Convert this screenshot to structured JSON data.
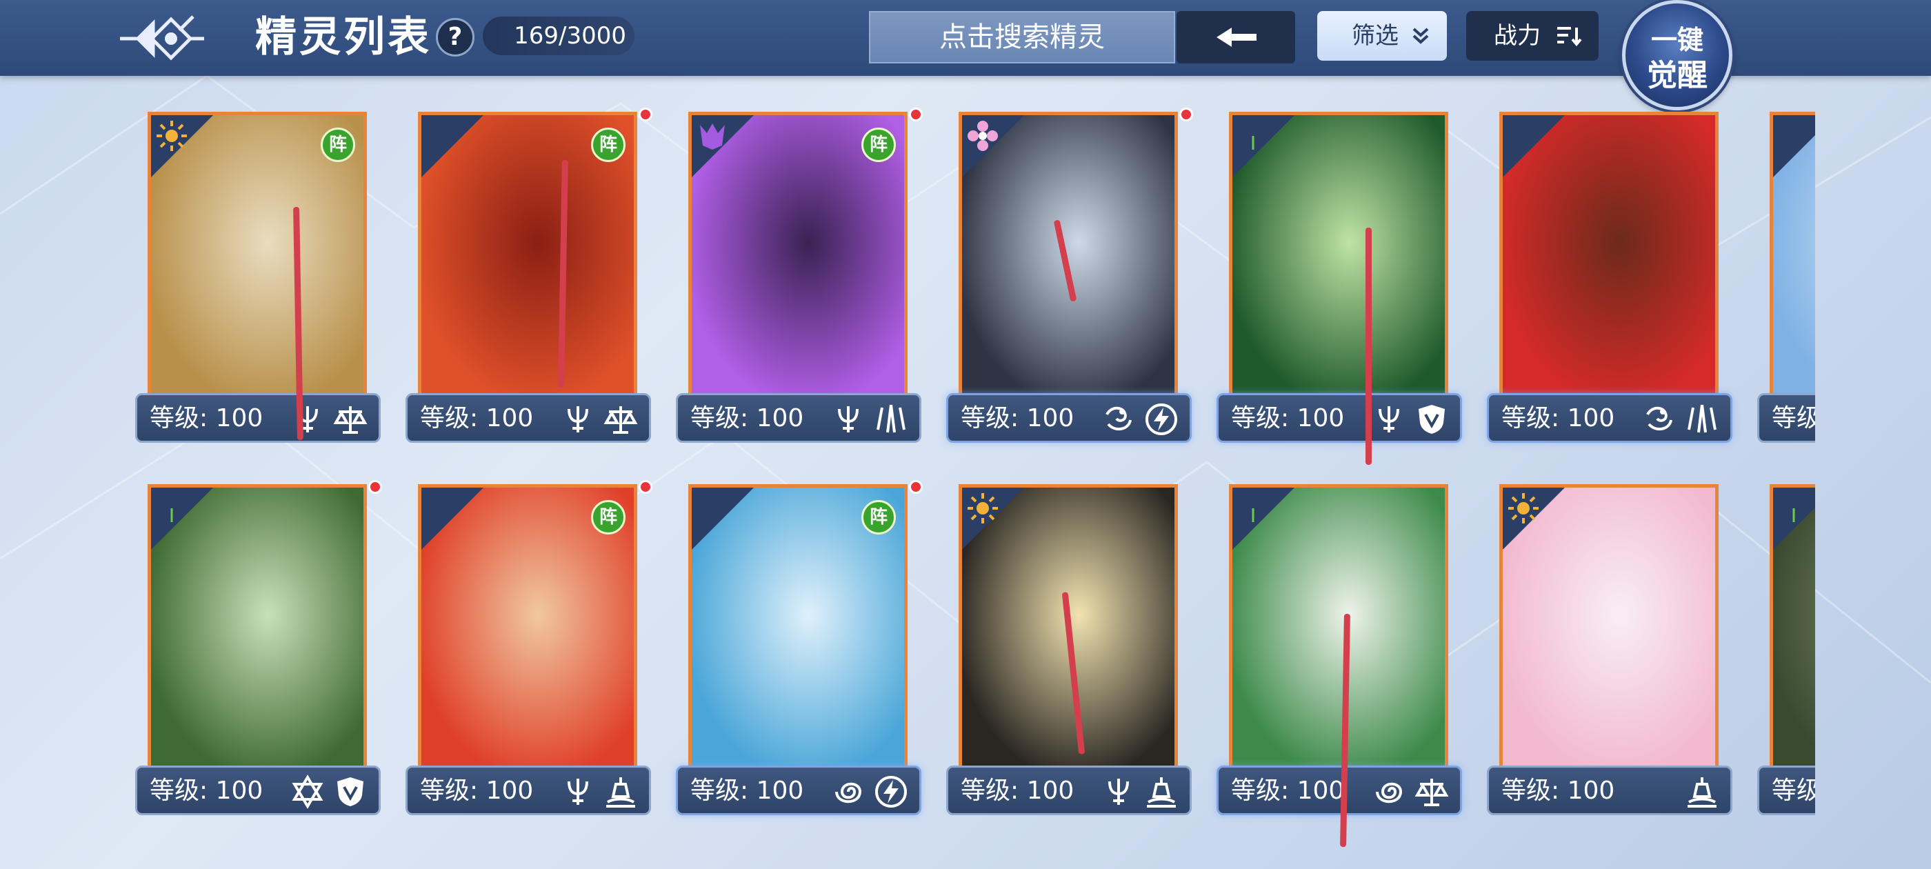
{
  "header": {
    "title": "精灵列表",
    "help": "?",
    "count": "169/3000",
    "search_placeholder": "点击搜索精灵",
    "filter_label": "筛选",
    "sort_label": "战力",
    "awaken_line1": "一键",
    "awaken_line2": "觉醒"
  },
  "colors": {
    "accent_orange": "#e8843a",
    "header_bg": "#2d4a7a",
    "badge_green": "#39a32e",
    "dot_red": "#e8333a"
  },
  "rows": [
    {
      "cards": [
        {
          "element": "light-icon",
          "element_color": "#f3b23a",
          "level": "等级: 100",
          "zhen": "阵",
          "dot": false,
          "skills": [
            "trident-icon",
            "scale-icon"
          ],
          "art": [
            "#e9dcc0",
            "#b8904a"
          ]
        },
        {
          "element": "fire-icon",
          "element_color": "#e94a3a",
          "level": "等级: 100",
          "zhen": "阵",
          "dot": true,
          "skills": [
            "trident-icon",
            "scale-icon"
          ],
          "art": [
            "#8b1f14",
            "#e0512a"
          ]
        },
        {
          "element": "shadow-icon",
          "element_color": "#a55be0",
          "level": "等级: 100",
          "zhen": "阵",
          "dot": true,
          "skills": [
            "trident-icon",
            "claw-icon"
          ],
          "art": [
            "#3a2253",
            "#b25fe8"
          ]
        },
        {
          "element": "flower-icon",
          "element_color": "#f0a5d8",
          "level": "等级: 100",
          "zhen": "",
          "dot": true,
          "skills": [
            "dragon-icon",
            "bolt-icon"
          ],
          "art": [
            "#cdd9e8",
            "#2e3443"
          ]
        },
        {
          "element": "leaf-icon",
          "element_color": "#6ecb4a",
          "level": "等级: 100",
          "zhen": "",
          "dot": false,
          "skills": [
            "trident-icon",
            "shield-icon"
          ],
          "art": [
            "#bfe3a4",
            "#1f5a2c"
          ]
        },
        {
          "element": "fire-icon",
          "element_color": "#e94a3a",
          "level": "等级: 100",
          "zhen": "",
          "dot": false,
          "skills": [
            "dragon-icon",
            "claw-icon"
          ],
          "art": [
            "#6c2a1a",
            "#d62a2a"
          ]
        },
        {
          "element": "water-icon",
          "element_color": "#5aa3f0",
          "level": "等级",
          "zhen": "",
          "dot": false,
          "skills": [],
          "art": [
            "#cfe3f6",
            "#7fb1e4"
          ]
        }
      ]
    },
    {
      "cards": [
        {
          "element": "leaf-icon",
          "element_color": "#6ecb4a",
          "level": "等级: 100",
          "zhen": "",
          "dot": true,
          "skills": [
            "hexagram-icon",
            "shield-icon"
          ],
          "art": [
            "#c9e0b8",
            "#3f6a33"
          ]
        },
        {
          "element": "fire-icon",
          "element_color": "#e94a3a",
          "level": "等级: 100",
          "zhen": "阵",
          "dot": true,
          "skills": [
            "trident-icon",
            "tower-icon"
          ],
          "art": [
            "#f0c8a0",
            "#e0402a"
          ]
        },
        {
          "element": "water-icon",
          "element_color": "#5aa3f0",
          "level": "等级: 100",
          "zhen": "阵",
          "dot": true,
          "skills": [
            "swirl-icon",
            "bolt-icon"
          ],
          "art": [
            "#dff0fb",
            "#4aa6d8"
          ]
        },
        {
          "element": "light-icon",
          "element_color": "#f3b23a",
          "level": "等级: 100",
          "zhen": "",
          "dot": false,
          "skills": [
            "trident-icon",
            "tower-icon"
          ],
          "art": [
            "#f2e3b0",
            "#2a2723"
          ]
        },
        {
          "element": "leaf-icon",
          "element_color": "#6ecb4a",
          "level": "等级: 100",
          "zhen": "",
          "dot": false,
          "skills": [
            "swirl-icon",
            "scale-icon"
          ],
          "art": [
            "#eef3ea",
            "#3d8a4a"
          ]
        },
        {
          "element": "light-icon",
          "element_color": "#f3b23a",
          "level": "等级: 100",
          "zhen": "",
          "dot": false,
          "skills": [
            "tower-icon"
          ],
          "art": [
            "#f8eef3",
            "#f2b8cf"
          ]
        },
        {
          "element": "leaf-icon",
          "element_color": "#6ecb4a",
          "level": "等级",
          "zhen": "",
          "dot": false,
          "skills": [],
          "art": [
            "#7f8b6a",
            "#3a4a30"
          ]
        }
      ]
    }
  ]
}
